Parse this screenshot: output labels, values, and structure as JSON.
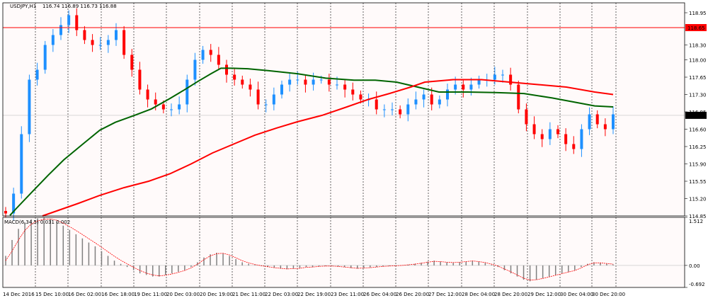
{
  "header": {
    "symbol": "USDJPY,H1",
    "ohlc": "116.74 116.89 116.73 116.88"
  },
  "price_scale": {
    "ticks": [
      "118.95",
      "118.30",
      "118.00",
      "117.65",
      "117.30",
      "116.95",
      "116.60",
      "116.25",
      "115.90",
      "115.55",
      "115.20",
      "114.85"
    ],
    "hline_label": "118.65",
    "current_label": "116.88"
  },
  "macd": {
    "label": "MACD(6,34,5) 0.031 0.002",
    "ticks": [
      "1.512",
      "0.00",
      "-0.692"
    ]
  },
  "time_labels": [
    "14 Dec 2016",
    "15 Dec 10:00",
    "16 Dec 02:00",
    "16 Dec 18:00",
    "19 Dec 11:00",
    "20 Dec 03:00",
    "20 Dec 19:00",
    "21 Dec 11:00",
    "22 Dec 03:00",
    "22 Dec 19:00",
    "23 Dec 11:00",
    "26 Dec 04:00",
    "26 Dec 20:00",
    "27 Dec 12:00",
    "28 Dec 04:00",
    "28 Dec 20:00",
    "29 Dec 12:00",
    "30 Dec 04:00",
    "30 Dec 20:00"
  ],
  "colors": {
    "background": "#fffafa",
    "bull": "#1e90ff",
    "bear": "#ff0000",
    "ma_fast": "#006400",
    "ma_slow": "#ff0000",
    "hline": "#ff0000",
    "histogram": "#808080",
    "signal": "#ff0000",
    "grid": "#000000"
  },
  "chart_data": [
    {
      "type": "candlestick",
      "title": "USDJPY,H1",
      "ylim": [
        114.85,
        119.15
      ],
      "horizontal_line": 118.65,
      "last_price": 116.88,
      "series": [
        {
          "name": "close",
          "kind": "candles",
          "values": [
            114.9,
            115.3,
            116.5,
            117.6,
            117.8,
            118.3,
            118.5,
            118.7,
            118.9,
            118.6,
            118.4,
            118.3,
            118.3,
            118.4,
            118.6,
            118.1,
            117.8,
            117.4,
            117.2,
            117.1,
            117.0,
            117.0,
            117.1,
            117.6,
            118.0,
            118.2,
            118.1,
            117.9,
            117.7,
            117.6,
            117.5,
            117.4,
            117.1,
            117.1,
            117.3,
            117.5,
            117.6,
            117.6,
            117.5,
            117.6,
            117.6,
            117.5,
            117.5,
            117.4,
            117.3,
            117.2,
            117.2,
            117.0,
            117.0,
            117.0,
            116.9,
            117.1,
            117.2,
            117.3,
            117.1,
            117.2,
            117.4,
            117.5,
            117.4,
            117.5,
            117.6,
            117.6,
            117.7,
            117.7,
            117.5,
            117.0,
            116.7,
            116.5,
            116.4,
            116.6,
            116.5,
            116.3,
            116.2,
            116.6,
            116.9,
            116.7,
            116.6,
            116.9
          ]
        },
        {
          "name": "moving average (green)",
          "kind": "line",
          "x": [
            14,
            23,
            45,
            68,
            90,
            117,
            141,
            163,
            190,
            214,
            240,
            260,
            279,
            298,
            312,
            328,
            350,
            380,
            420,
            460,
            500,
            530,
            560,
            590,
            620,
            660,
            700,
            740,
            780,
            810,
            840,
            866
          ],
          "values": [
            114.86,
            115.0,
            115.33,
            115.67,
            115.98,
            116.3,
            116.58,
            116.74,
            116.88,
            117.01,
            117.22,
            117.39,
            117.56,
            117.72,
            117.83,
            117.83,
            117.82,
            117.78,
            117.72,
            117.63,
            117.59,
            117.59,
            117.55,
            117.45,
            117.35,
            117.35,
            117.34,
            117.32,
            117.23,
            117.15,
            117.07,
            117.05
          ]
        },
        {
          "name": "moving average (red)",
          "kind": "line",
          "x": [
            60,
            80,
            110,
            140,
            175,
            210,
            240,
            270,
            300,
            330,
            360,
            390,
            420,
            455,
            490,
            520,
            550,
            580,
            600,
            640,
            680,
            720,
            760,
            800,
            840,
            866
          ],
          "values": [
            114.85,
            114.95,
            115.1,
            115.26,
            115.42,
            115.55,
            115.7,
            115.9,
            116.12,
            116.3,
            116.48,
            116.62,
            116.75,
            116.88,
            117.05,
            117.2,
            117.32,
            117.45,
            117.55,
            117.6,
            117.6,
            117.55,
            117.5,
            117.45,
            117.35,
            117.3
          ]
        }
      ]
    },
    {
      "type": "bar",
      "title": "MACD(6,34,5) 0.031 0.002",
      "ylim": [
        -0.692,
        1.512
      ],
      "series": [
        {
          "name": "histogram",
          "values": [
            0.3,
            0.8,
            1.15,
            1.35,
            1.45,
            1.48,
            1.5,
            1.46,
            1.38,
            1.25,
            1.12,
            0.98,
            0.85,
            0.72,
            0.6,
            0.45,
            0.3,
            0.15,
            0.05,
            -0.05,
            -0.15,
            -0.25,
            -0.3,
            -0.35,
            -0.35,
            -0.3,
            -0.25,
            -0.2,
            -0.15,
            -0.05,
            0.1,
            0.25,
            0.35,
            0.4,
            0.38,
            0.3,
            0.2,
            0.1,
            0.05,
            0.02,
            -0.02,
            -0.05,
            -0.08,
            -0.1,
            -0.12,
            -0.1,
            -0.08,
            -0.05,
            -0.05,
            -0.03,
            -0.02,
            -0.02,
            -0.03,
            -0.05,
            -0.08,
            -0.1,
            -0.08,
            -0.06,
            -0.05,
            -0.03,
            -0.02,
            -0.02,
            0.0,
            0.02,
            0.05,
            0.08,
            0.12,
            0.15,
            0.12,
            0.1,
            0.08,
            0.1,
            0.12,
            0.15,
            0.12,
            0.08,
            0.02,
            -0.05,
            -0.15,
            -0.25,
            -0.35,
            -0.45,
            -0.5,
            -0.45,
            -0.4,
            -0.35,
            -0.3,
            -0.25,
            -0.2,
            -0.15,
            -0.05,
            0.05,
            0.1,
            0.08,
            0.05,
            0.03
          ]
        },
        {
          "name": "signal",
          "values": [
            0.15,
            0.45,
            0.8,
            1.1,
            1.3,
            1.4,
            1.45,
            1.46,
            1.42,
            1.33,
            1.22,
            1.1,
            0.97,
            0.84,
            0.71,
            0.57,
            0.43,
            0.29,
            0.16,
            0.05,
            -0.06,
            -0.16,
            -0.24,
            -0.3,
            -0.33,
            -0.31,
            -0.27,
            -0.22,
            -0.16,
            -0.08,
            0.04,
            0.18,
            0.3,
            0.37,
            0.38,
            0.33,
            0.24,
            0.15,
            0.08,
            0.03,
            -0.01,
            -0.04,
            -0.07,
            -0.09,
            -0.11,
            -0.1,
            -0.09,
            -0.06,
            -0.05,
            -0.03,
            -0.02,
            -0.02,
            -0.03,
            -0.05,
            -0.07,
            -0.09,
            -0.08,
            -0.07,
            -0.05,
            -0.03,
            -0.02,
            -0.01,
            0.0,
            0.02,
            0.04,
            0.07,
            0.1,
            0.13,
            0.12,
            0.1,
            0.09,
            0.1,
            0.12,
            0.14,
            0.12,
            0.09,
            0.04,
            -0.02,
            -0.11,
            -0.2,
            -0.3,
            -0.4,
            -0.46,
            -0.45,
            -0.41,
            -0.36,
            -0.31,
            -0.26,
            -0.21,
            -0.16,
            -0.08,
            0.02,
            0.08,
            0.08,
            0.06,
            0.04
          ]
        }
      ]
    }
  ]
}
